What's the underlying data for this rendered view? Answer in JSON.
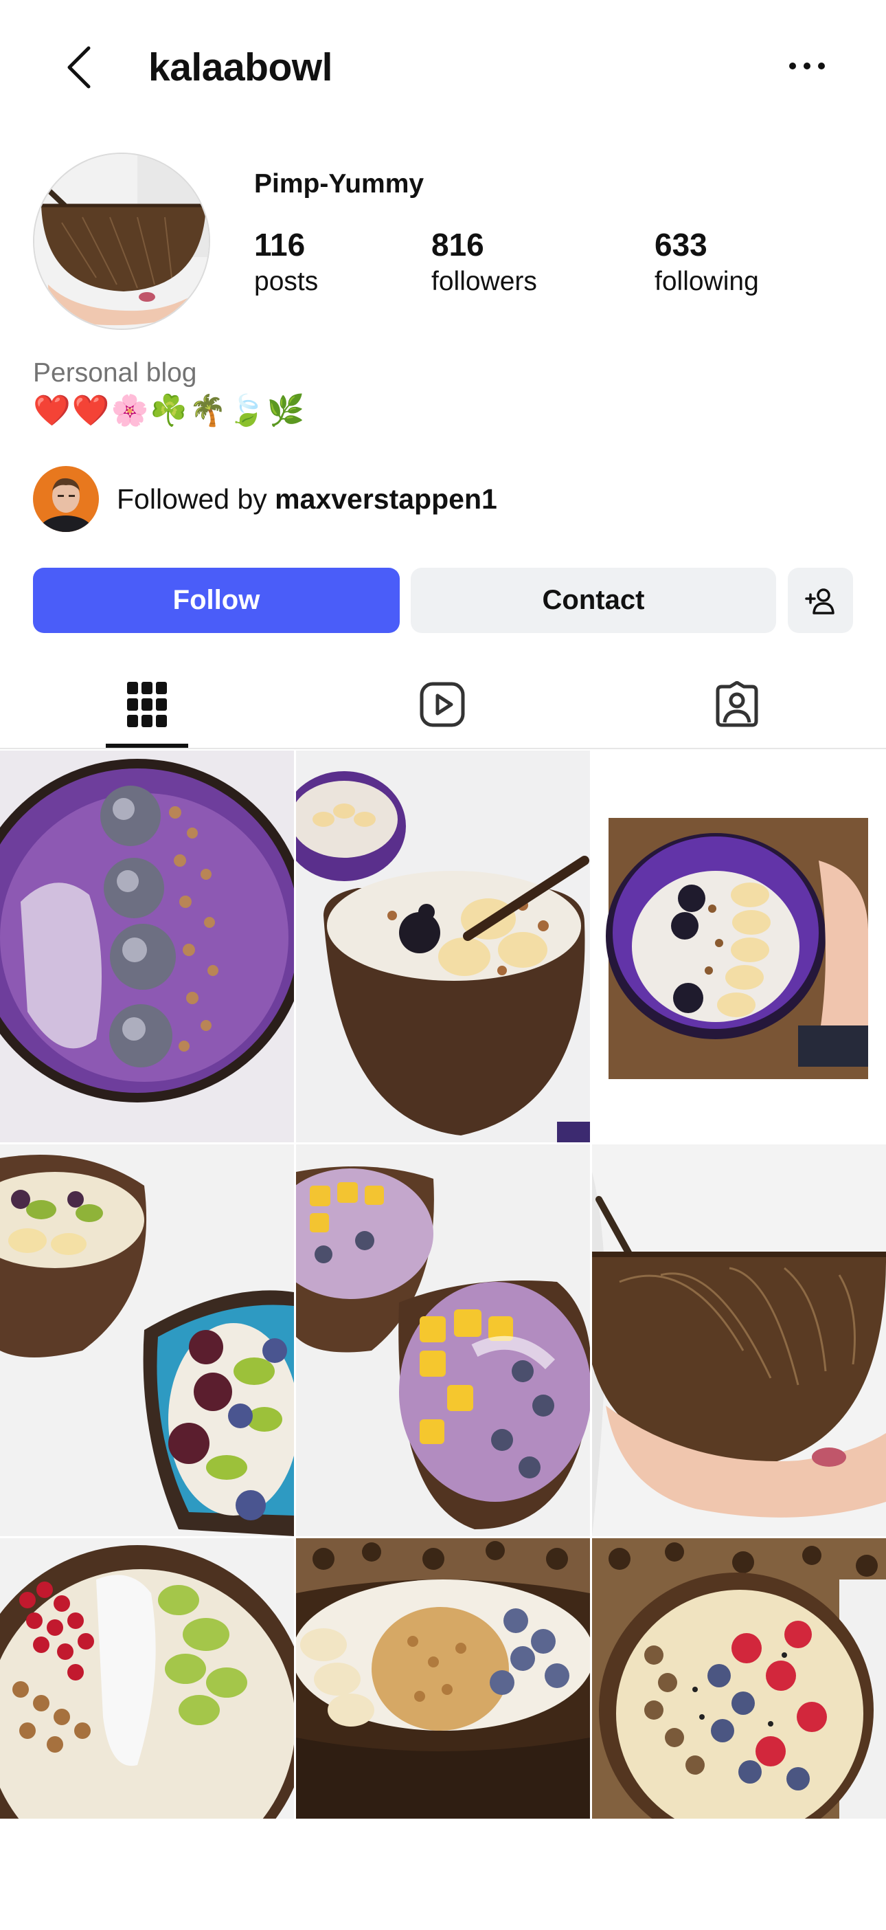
{
  "header": {
    "back_icon": "chevron-left-icon",
    "username": "kalaabowl",
    "more_icon": "ellipsis-icon"
  },
  "profile": {
    "display_name": "Pimp-Yummy",
    "stats": [
      {
        "value": "116",
        "label": "posts"
      },
      {
        "value": "816",
        "label": "followers"
      },
      {
        "value": "633",
        "label": "following"
      }
    ],
    "category": "Personal blog",
    "bio": "❤️❤️🌸☘️🌴🍃🌿",
    "followed_by_prefix": "Followed by ",
    "followed_by_user": "maxverstappen1"
  },
  "actions": {
    "follow_label": "Follow",
    "contact_label": "Contact",
    "suggest_icon": "add-person-icon"
  },
  "tabs": [
    {
      "name": "grid",
      "icon": "grid-icon",
      "selected": true
    },
    {
      "name": "reels",
      "icon": "reels-play-icon",
      "selected": false
    },
    {
      "name": "tagged",
      "icon": "tagged-person-icon",
      "selected": false
    }
  ],
  "colors": {
    "follow_button": "#4a5df9",
    "secondary_button": "#eff1f3",
    "muted_text": "#737373"
  },
  "posts": [
    {
      "subject": "purple smoothie bowl with blackberries, coconut and nuts"
    },
    {
      "subject": "coconut bowl with banana, blackberries and granola"
    },
    {
      "subject": "hand holding purple coconut bowl with banana and berries"
    },
    {
      "subject": "two bowls with grapes, kiwi and blueberries"
    },
    {
      "subject": "two bowls with mango, blueberries and chocolate"
    },
    {
      "subject": "hand holding carved coconut bowl"
    },
    {
      "subject": "bowl with pomegranate, coconut and kiwi"
    },
    {
      "subject": "bowl with granola, banana and blueberries"
    },
    {
      "subject": "bowl with raspberries, blueberries and chia"
    }
  ]
}
